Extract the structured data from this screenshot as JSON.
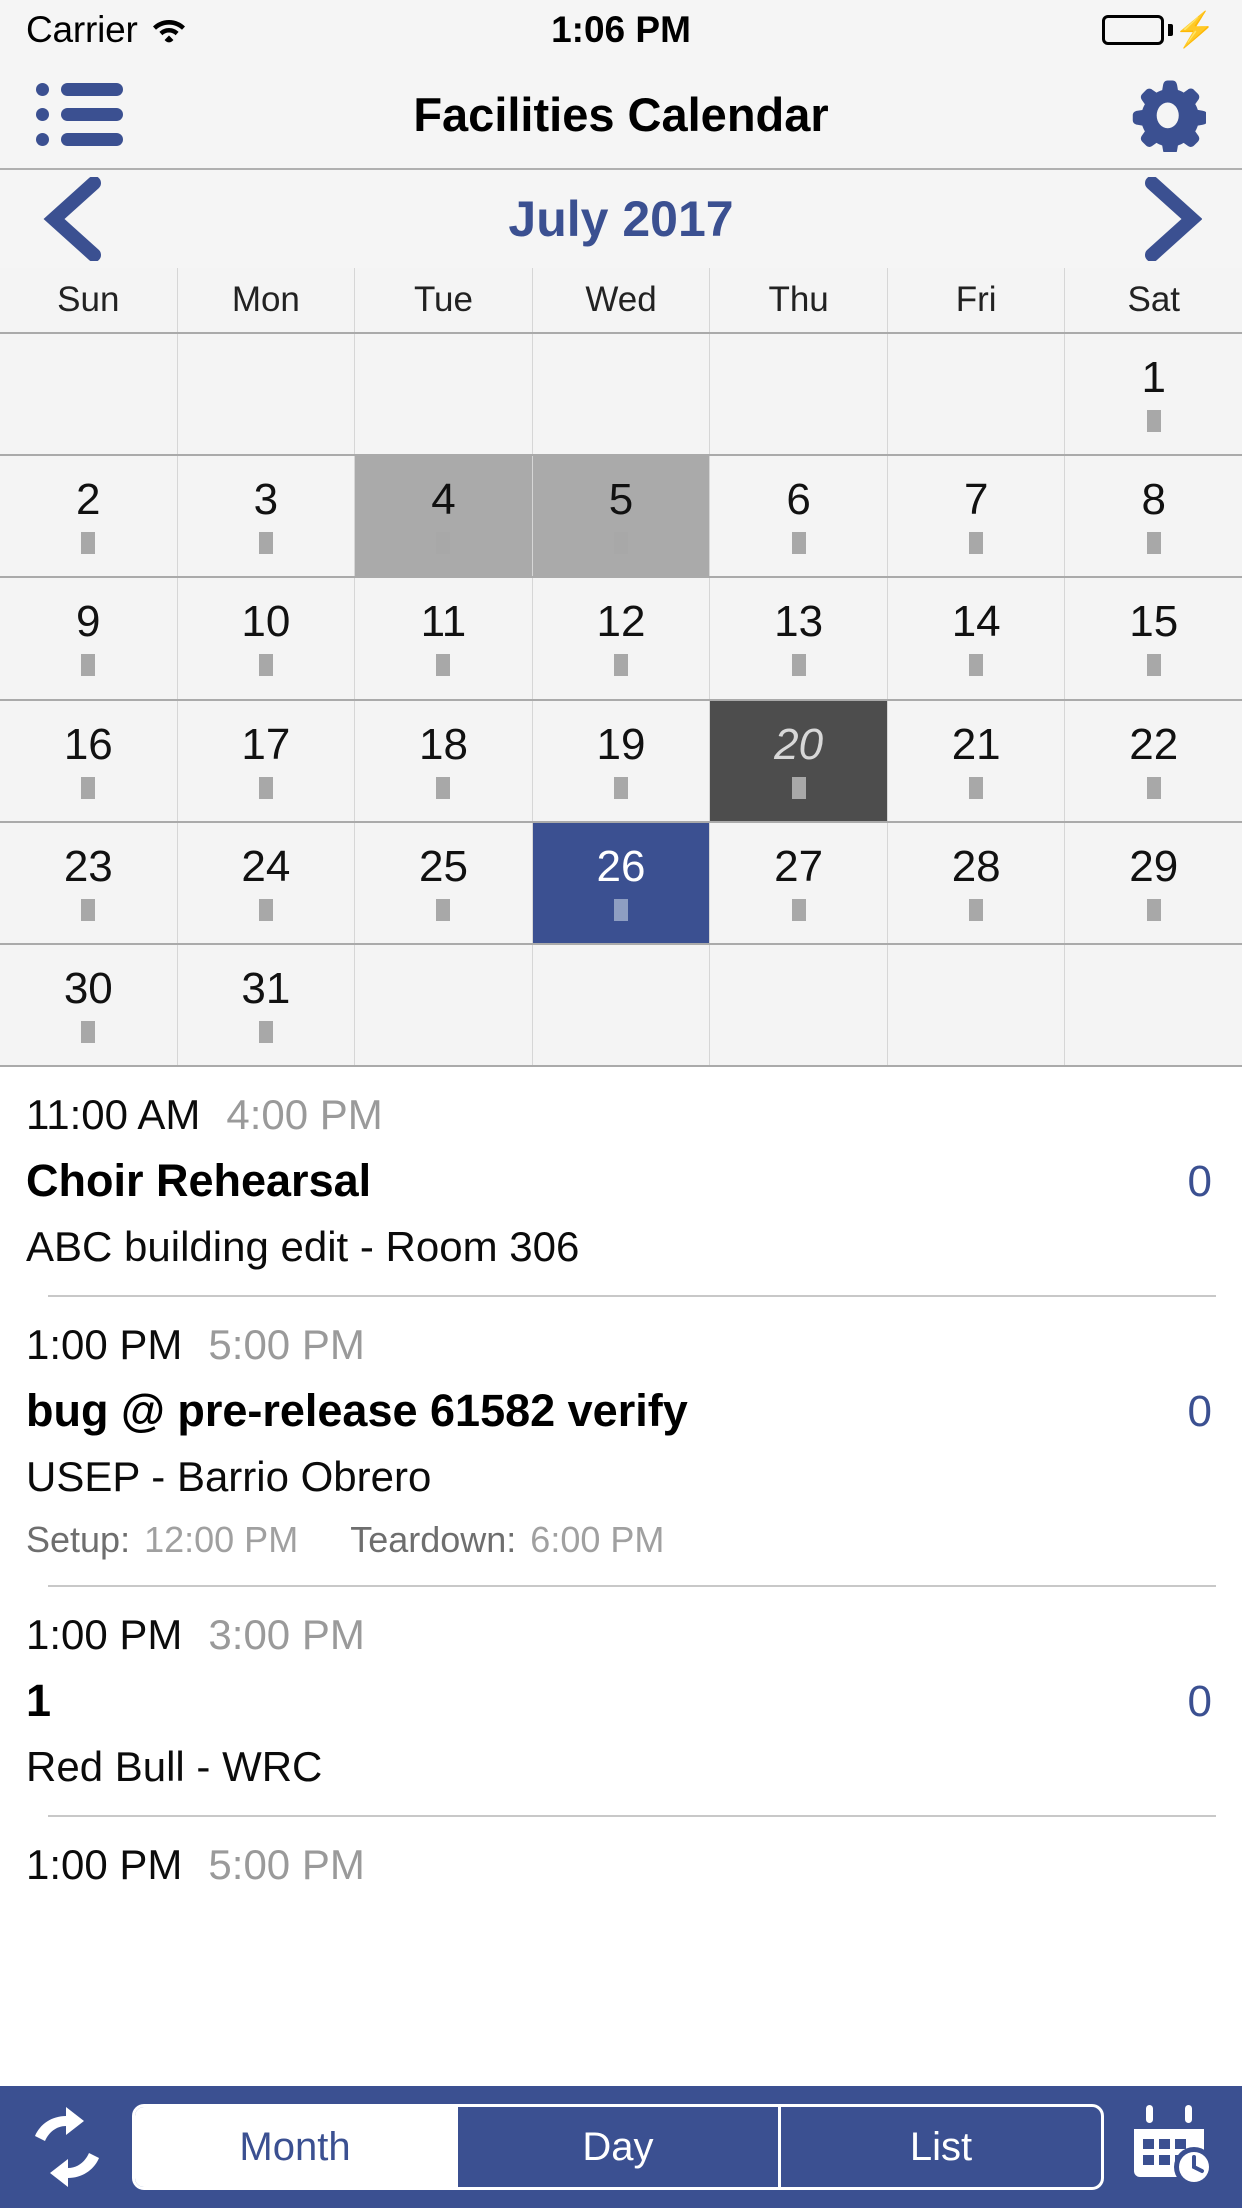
{
  "status_bar": {
    "carrier": "Carrier",
    "wifi_icon": "wifi-icon",
    "time": "1:06 PM",
    "battery_icon": "battery-icon",
    "charging_icon": "lightning-bolt-icon"
  },
  "nav_bar": {
    "menu_icon": "list-menu-icon",
    "title": "Facilities Calendar",
    "settings_icon": "gear-icon"
  },
  "month_header": {
    "prev_icon": "chevron-left-icon",
    "title": "July 2017",
    "next_icon": "chevron-right-icon"
  },
  "weekdays": [
    "Sun",
    "Mon",
    "Tue",
    "Wed",
    "Thu",
    "Fri",
    "Sat"
  ],
  "calendar": {
    "month": "July",
    "year": "2017",
    "selected_day": "26",
    "today": "20",
    "range_days": [
      "4",
      "5"
    ],
    "weeks": [
      [
        {
          "day": "",
          "state": "empty",
          "dot": false
        },
        {
          "day": "",
          "state": "empty",
          "dot": false
        },
        {
          "day": "",
          "state": "empty",
          "dot": false
        },
        {
          "day": "",
          "state": "empty",
          "dot": false
        },
        {
          "day": "",
          "state": "empty",
          "dot": false
        },
        {
          "day": "",
          "state": "empty",
          "dot": false
        },
        {
          "day": "1",
          "state": "normal",
          "dot": true
        }
      ],
      [
        {
          "day": "2",
          "state": "normal",
          "dot": true
        },
        {
          "day": "3",
          "state": "normal",
          "dot": true
        },
        {
          "day": "4",
          "state": "range",
          "dot": true
        },
        {
          "day": "5",
          "state": "range",
          "dot": true
        },
        {
          "day": "6",
          "state": "normal",
          "dot": true
        },
        {
          "day": "7",
          "state": "normal",
          "dot": true
        },
        {
          "day": "8",
          "state": "normal",
          "dot": true
        }
      ],
      [
        {
          "day": "9",
          "state": "normal",
          "dot": true
        },
        {
          "day": "10",
          "state": "normal",
          "dot": true
        },
        {
          "day": "11",
          "state": "normal",
          "dot": true
        },
        {
          "day": "12",
          "state": "normal",
          "dot": true
        },
        {
          "day": "13",
          "state": "normal",
          "dot": true
        },
        {
          "day": "14",
          "state": "normal",
          "dot": true
        },
        {
          "day": "15",
          "state": "normal",
          "dot": true
        }
      ],
      [
        {
          "day": "16",
          "state": "normal",
          "dot": true
        },
        {
          "day": "17",
          "state": "normal",
          "dot": true
        },
        {
          "day": "18",
          "state": "normal",
          "dot": true
        },
        {
          "day": "19",
          "state": "normal",
          "dot": true
        },
        {
          "day": "20",
          "state": "today",
          "dot": true
        },
        {
          "day": "21",
          "state": "normal",
          "dot": true
        },
        {
          "day": "22",
          "state": "normal",
          "dot": true
        }
      ],
      [
        {
          "day": "23",
          "state": "normal",
          "dot": true
        },
        {
          "day": "24",
          "state": "normal",
          "dot": true
        },
        {
          "day": "25",
          "state": "normal",
          "dot": true
        },
        {
          "day": "26",
          "state": "selected",
          "dot": true
        },
        {
          "day": "27",
          "state": "normal",
          "dot": true
        },
        {
          "day": "28",
          "state": "normal",
          "dot": true
        },
        {
          "day": "29",
          "state": "normal",
          "dot": true
        }
      ],
      [
        {
          "day": "30",
          "state": "normal",
          "dot": true
        },
        {
          "day": "31",
          "state": "normal",
          "dot": true
        },
        {
          "day": "",
          "state": "empty",
          "dot": false
        },
        {
          "day": "",
          "state": "empty",
          "dot": false
        },
        {
          "day": "",
          "state": "empty",
          "dot": false
        },
        {
          "day": "",
          "state": "empty",
          "dot": false
        },
        {
          "day": "",
          "state": "empty",
          "dot": false
        }
      ]
    ]
  },
  "events": [
    {
      "start_time": "11:00 AM",
      "end_time": "4:00 PM",
      "title": "Choir Rehearsal",
      "count": "0",
      "location": "ABC building edit - Room 306",
      "setup_label": "",
      "setup_time": "",
      "teardown_label": "",
      "teardown_time": ""
    },
    {
      "start_time": "1:00 PM",
      "end_time": "5:00 PM",
      "title": "bug @ pre-release 61582 verify",
      "count": "0",
      "location": "USEP - Barrio Obrero",
      "setup_label": "Setup:",
      "setup_time": "12:00 PM",
      "teardown_label": "Teardown:",
      "teardown_time": "6:00 PM"
    },
    {
      "start_time": "1:00 PM",
      "end_time": "3:00 PM",
      "title": "1",
      "count": "0",
      "location": "Red Bull - WRC",
      "setup_label": "",
      "setup_time": "",
      "teardown_label": "",
      "teardown_time": ""
    },
    {
      "start_time": "1:00 PM",
      "end_time": "5:00 PM",
      "title": "",
      "count": "",
      "location": "",
      "setup_label": "",
      "setup_time": "",
      "teardown_label": "",
      "teardown_time": ""
    }
  ],
  "toolbar": {
    "refresh_icon": "refresh-sync-icon",
    "segments": [
      {
        "label": "Month",
        "active": true
      },
      {
        "label": "Day",
        "active": false
      },
      {
        "label": "List",
        "active": false
      }
    ],
    "calendar_clock_icon": "calendar-clock-icon"
  },
  "colors": {
    "accent": "#3b5091",
    "today_bg": "#4d4d4d",
    "range_bg": "#aaaaaa",
    "battery_green": "#4cd964"
  }
}
